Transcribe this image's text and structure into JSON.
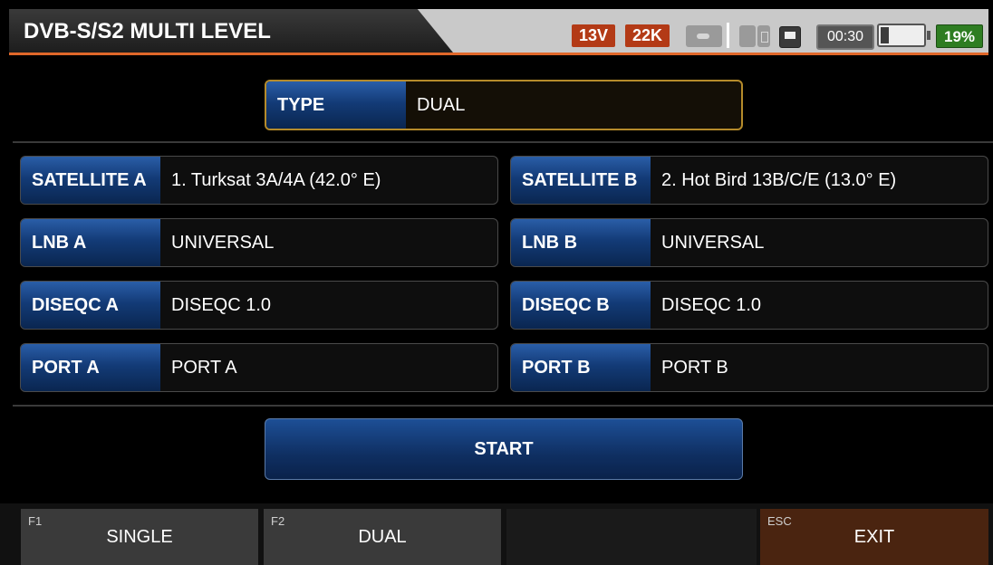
{
  "header": {
    "title": "DVB-S/S2 MULTI LEVEL",
    "voltage": "13V",
    "tone": "22K",
    "time": "00:30",
    "battery_percent": "19%",
    "battery_level": 0.19,
    "accent_color": "#e0672a",
    "icons": [
      "usb-icon",
      "sd-card-icon",
      "ethernet-icon",
      "battery-icon"
    ]
  },
  "type": {
    "label": "TYPE",
    "value": "DUAL"
  },
  "left": {
    "satellite": {
      "label": "SATELLITE A",
      "value": "1. Turksat 3A/4A (42.0° E)"
    },
    "lnb": {
      "label": "LNB A",
      "value": "UNIVERSAL"
    },
    "diseqc": {
      "label": "DISEQC A",
      "value": "DISEQC 1.0"
    },
    "port": {
      "label": "PORT A",
      "value": "PORT A"
    }
  },
  "right": {
    "satellite": {
      "label": "SATELLITE B",
      "value": "2. Hot Bird 13B/C/E (13.0° E)"
    },
    "lnb": {
      "label": "LNB B",
      "value": "UNIVERSAL"
    },
    "diseqc": {
      "label": "DISEQC B",
      "value": "DISEQC 1.0"
    },
    "port": {
      "label": "PORT B",
      "value": "PORT B"
    }
  },
  "start_label": "START",
  "function_keys": [
    {
      "key": "F1",
      "label": "SINGLE"
    },
    {
      "key": "F2",
      "label": "DUAL"
    },
    {
      "key": "ESC",
      "label": "EXIT"
    }
  ]
}
